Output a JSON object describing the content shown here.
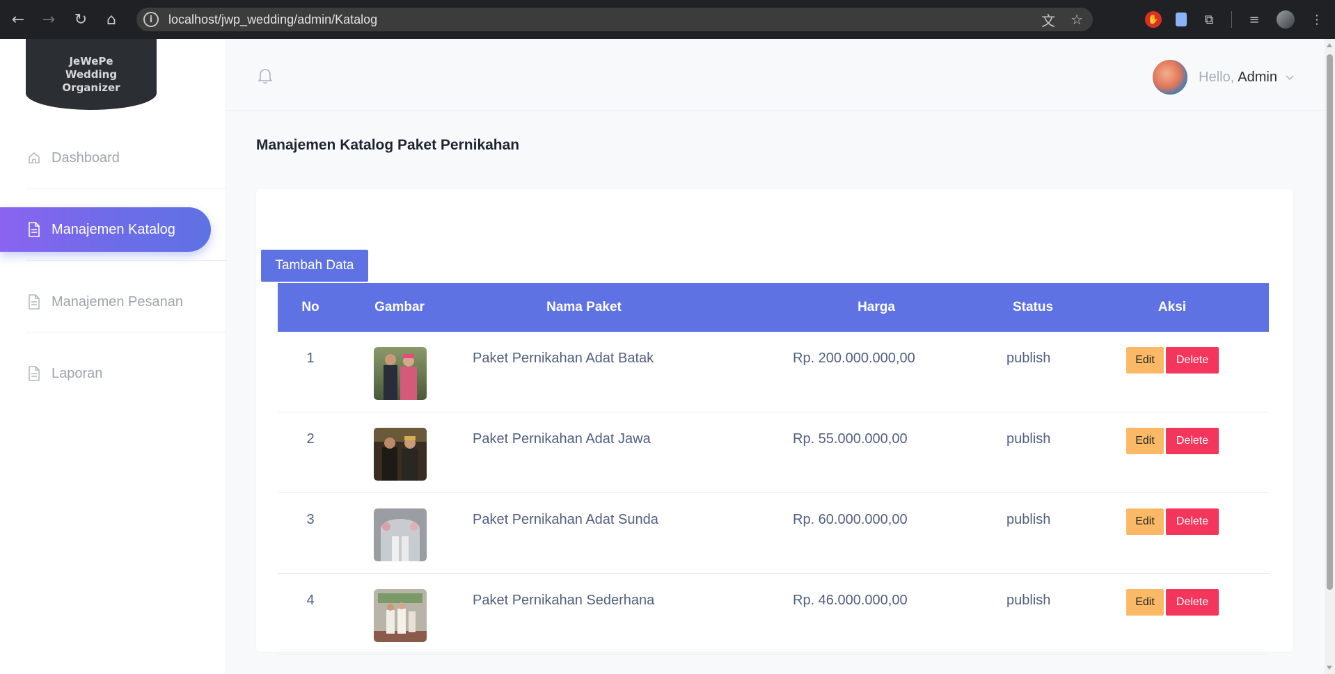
{
  "browser": {
    "url": "localhost/jwp_wedding/admin/Katalog",
    "icons": [
      "back-icon",
      "forward-icon",
      "reload-icon",
      "home-icon",
      "site-info-icon",
      "translate-icon",
      "bookmark-star-icon",
      "extension-red-icon",
      "extension-blue-icon",
      "extensions-puzzle-icon",
      "media-control-icon",
      "profile-icon",
      "more-menu-icon"
    ]
  },
  "sidebar": {
    "logo_text": "JeWePe\nWedding\nOrganizer",
    "items": [
      {
        "label": "Dashboard",
        "icon": "home-icon",
        "active": false
      },
      {
        "label": "Manajemen Katalog",
        "icon": "document-icon",
        "active": true
      },
      {
        "label": "Manajemen Pesanan",
        "icon": "document-icon",
        "active": false
      },
      {
        "label": "Laporan",
        "icon": "document-icon",
        "active": false
      }
    ]
  },
  "header": {
    "greeting": "Hello,",
    "username": "Admin"
  },
  "page": {
    "title": "Manajemen Katalog Paket Pernikahan",
    "add_button": "Tambah Data"
  },
  "table": {
    "columns": [
      "No",
      "Gambar",
      "Nama Paket",
      "Harga",
      "Status",
      "Aksi"
    ],
    "rows": [
      {
        "no": "1",
        "name": "Paket Pernikahan Adat Batak",
        "price": "Rp. 200.000.000,00",
        "status": "publish",
        "edit": "Edit",
        "delete": "Delete"
      },
      {
        "no": "2",
        "name": "Paket Pernikahan Adat Jawa",
        "price": "Rp. 55.000.000,00",
        "status": "publish",
        "edit": "Edit",
        "delete": "Delete"
      },
      {
        "no": "3",
        "name": "Paket Pernikahan Adat Sunda",
        "price": "Rp. 60.000.000,00",
        "status": "publish",
        "edit": "Edit",
        "delete": "Delete"
      },
      {
        "no": "4",
        "name": "Paket Pernikahan Sederhana",
        "price": "Rp. 46.000.000,00",
        "status": "publish",
        "edit": "Edit",
        "delete": "Delete"
      }
    ]
  },
  "colors": {
    "primary": "#5e72e4",
    "edit": "#fbb966",
    "delete": "#f5365c",
    "sidebar_active_start": "#8a64f0"
  }
}
